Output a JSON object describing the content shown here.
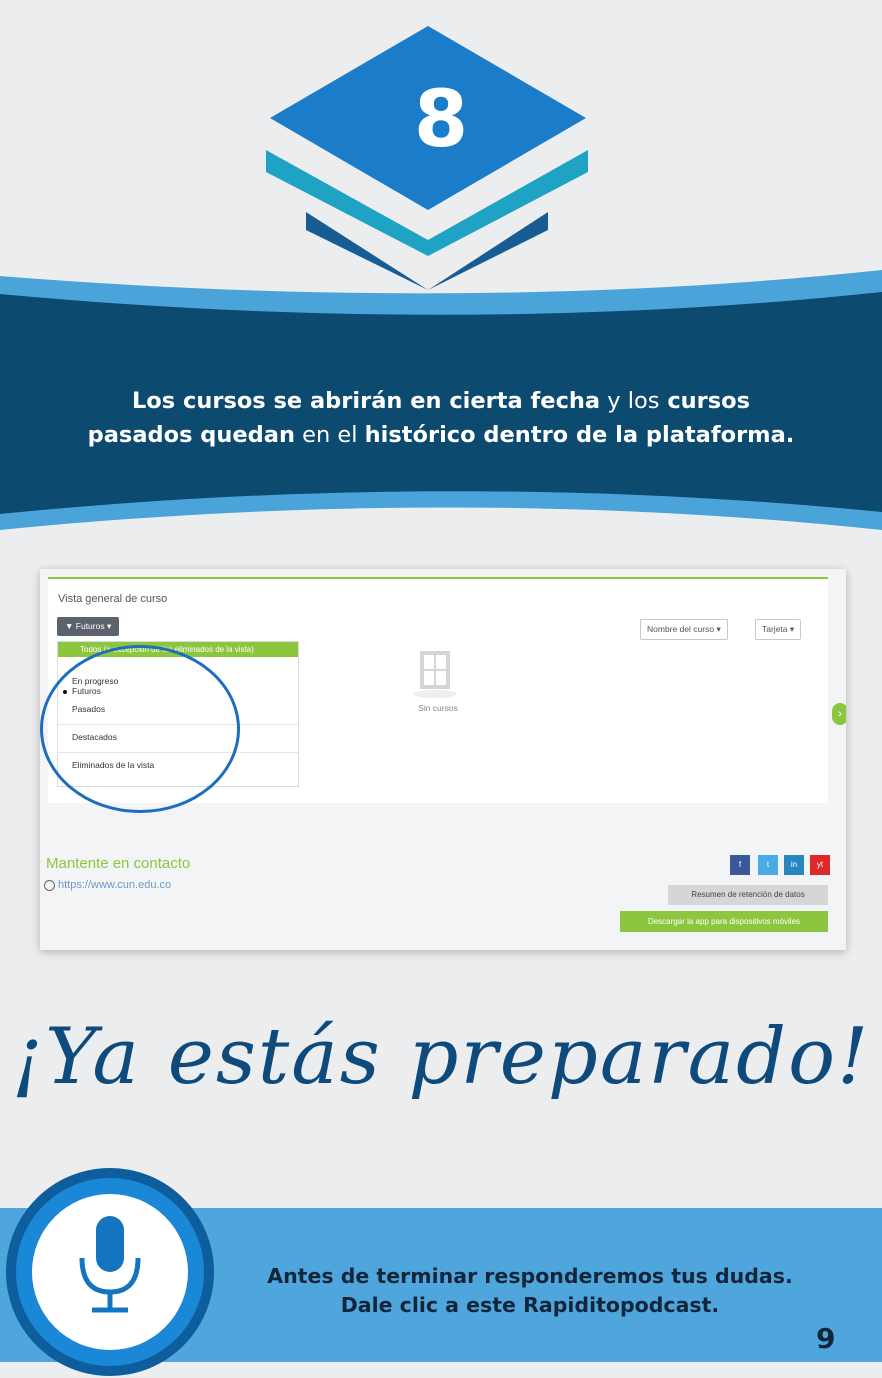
{
  "step_number": "8",
  "banner": {
    "p1": "Los cursos se abrirán en cierta fecha",
    "p2": " y ",
    "p3": "los",
    "p4": " cursos",
    "p5": "pasados quedan",
    "p6": " en el ",
    "p7": "histórico dentro de la plataforma."
  },
  "screenshot": {
    "title": "Vista general de curso",
    "filter_label": "Futuros",
    "dropdown_header": "Todos (a excepción de los eliminados de la vista)",
    "dropdown_items": [
      "En progreso",
      "Futuros",
      "Pasados",
      "Destacados",
      "Eliminados de la vista"
    ],
    "selected_item": "Futuros",
    "sort_label": "Nombre del curso",
    "view_label": "Tarjeta",
    "empty_label": "Sin cursos",
    "contact_title": "Mantente en contacto",
    "contact_link": "https://www.cun.edu.co",
    "social": [
      "f",
      "t",
      "in",
      "yt"
    ],
    "retention_label": "Resumen de retención de datos",
    "download_label": "Descargar la app para dispositivos móviles"
  },
  "slogan": "¡Ya estás preparado!",
  "podcast": {
    "line1": "Antes de terminar responderemos tus dudas.",
    "line2": "Dale clic a este Rapiditopodcast."
  },
  "page_number": "9",
  "colors": {
    "dark_blue": "#0d4a70",
    "light_blue": "#4ea6dc",
    "accent_green": "#8cc63f",
    "diamond_blue": "#1b7cc9"
  },
  "icons": [
    "layers-icon",
    "microphone-icon",
    "filter-icon",
    "globe-icon"
  ]
}
